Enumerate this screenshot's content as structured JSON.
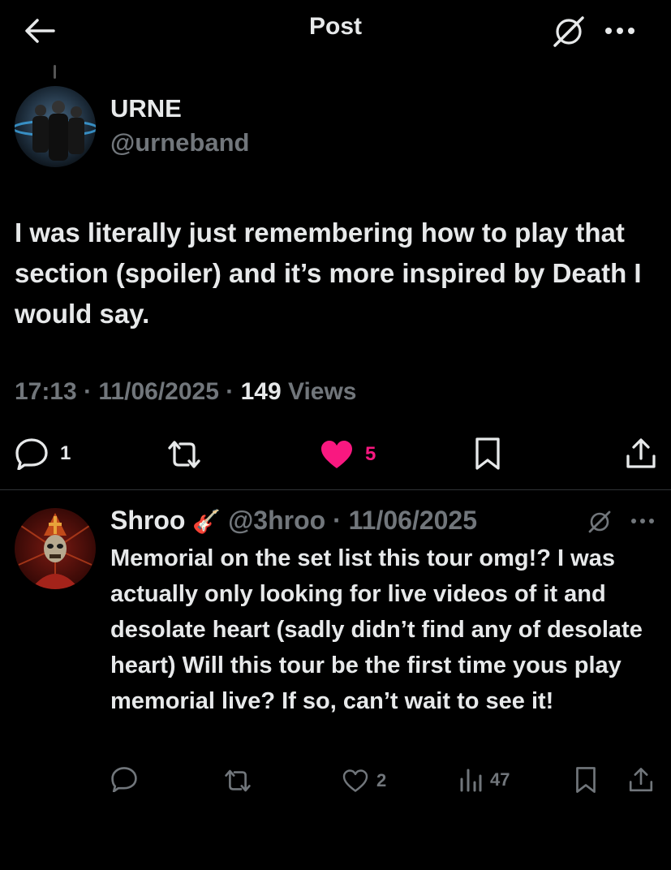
{
  "header": {
    "back_icon": "arrow-left-icon",
    "title": "Post",
    "grok_icon": "grok-icon",
    "more_icon": "more-dots-icon"
  },
  "post": {
    "author_name": "URNE",
    "author_handle": "@urneband",
    "text": "I was literally just remembering how to play that section (spoiler) and it’s more inspired by Death I would say.",
    "time": "17:13",
    "date": "11/06/2025",
    "views_count": "149",
    "views_label": "Views",
    "reply_count": "1",
    "like_count": "5",
    "liked": true,
    "like_color": "#f91880"
  },
  "reply": {
    "author_name": "Shroo",
    "author_emoji": "🎸",
    "author_handle": "@3hroo",
    "date": "11/06/2025",
    "text": "Memorial on the set list this tour omg!? I was actually only looking for live videos of it and desolate heart (sadly didn’t find any of desolate heart) Will this tour be the first time yous play memorial live? If so, can’t wait to see it!",
    "like_count": "2",
    "views_count": "47"
  },
  "colors": {
    "background": "#000000",
    "text": "#e7e9ea",
    "muted": "#71767b",
    "like": "#f91880",
    "divider": "#2f3336"
  }
}
